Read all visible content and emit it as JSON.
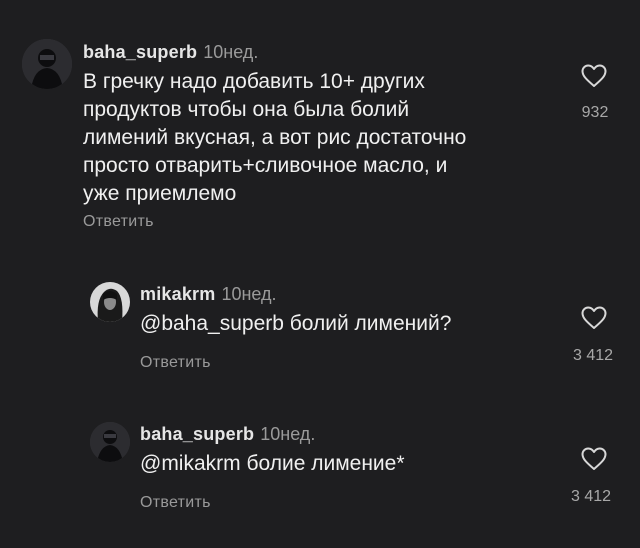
{
  "comments": [
    {
      "username": "baha_superb",
      "time": "10нед.",
      "text": "В гречку надо добавить 10+ других\nпродуктов чтобы она была болий\nлимений вкусная, а вот рис достаточно\nпросто отварить+сливочное масло, и\nуже приемлемо",
      "reply_label": "Ответить",
      "likes": "932",
      "like_icon": "heart-outline-icon"
    },
    {
      "username": "mikakrm",
      "time": "10нед.",
      "text": "@baha_superb болий лимений?",
      "reply_label": "Ответить",
      "likes": "3 412",
      "like_icon": "heart-outline-icon"
    },
    {
      "username": "baha_superb",
      "time": "10нед.",
      "text": "@mikakrm болие лимение*",
      "reply_label": "Ответить",
      "likes": "3 412",
      "like_icon": "heart-outline-icon"
    }
  ],
  "colors": {
    "background": "#1e1e20",
    "text": "#f0f0f0",
    "muted": "#9a9a9a"
  }
}
